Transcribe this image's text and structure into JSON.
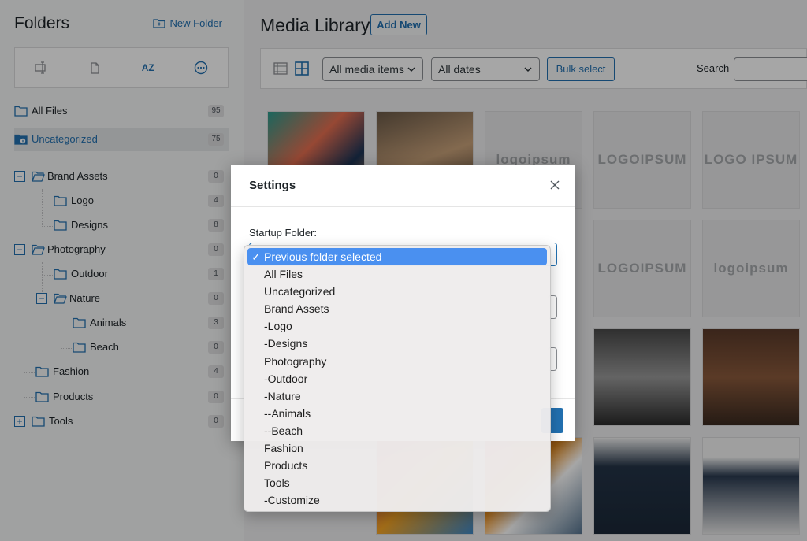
{
  "sidebar": {
    "title": "Folders",
    "new_folder_label": "New Folder",
    "tool_icons": [
      "rename-icon",
      "duplicate-icon",
      "sort-az-icon",
      "more-icon"
    ],
    "sort_label": "AZ",
    "items": [
      {
        "label": "All Files",
        "count": "95"
      },
      {
        "label": "Uncategorized",
        "count": "75",
        "active": true
      },
      {
        "label": "Brand Assets",
        "count": "0"
      },
      {
        "label": "Logo",
        "count": "4"
      },
      {
        "label": "Designs",
        "count": "8"
      },
      {
        "label": "Photography",
        "count": "0"
      },
      {
        "label": "Outdoor",
        "count": "1"
      },
      {
        "label": "Nature",
        "count": "0"
      },
      {
        "label": "Animals",
        "count": "3"
      },
      {
        "label": "Beach",
        "count": "0"
      },
      {
        "label": "Fashion",
        "count": "4"
      },
      {
        "label": "Products",
        "count": "0"
      },
      {
        "label": "Tools",
        "count": "0"
      }
    ]
  },
  "main": {
    "title": "Media Library",
    "add_new_label": "Add New",
    "filter_media": "All media items",
    "filter_dates": "All dates",
    "bulk_select_label": "Bulk select",
    "search_label": "Search",
    "logo_texts": [
      "logoipsum",
      "LOGOIPSUM",
      "LOGO IPSUM",
      "LOGOIPSUM",
      "logoipsum"
    ]
  },
  "modal": {
    "title": "Settings",
    "field_label": "Startup Folder:",
    "selected_value": "Previous folder selected",
    "options": [
      "Previous folder selected",
      "All Files",
      "Uncategorized",
      "Brand Assets",
      "-Logo",
      "-Designs",
      "Photography",
      "-Outdoor",
      "-Nature",
      "--Animals",
      "--Beach",
      "Fashion",
      "Products",
      "Tools",
      "-Customize"
    ],
    "check_glyph": "✓"
  },
  "colors": {
    "accent": "#2271b1",
    "selected_option": "#4a90f0"
  }
}
